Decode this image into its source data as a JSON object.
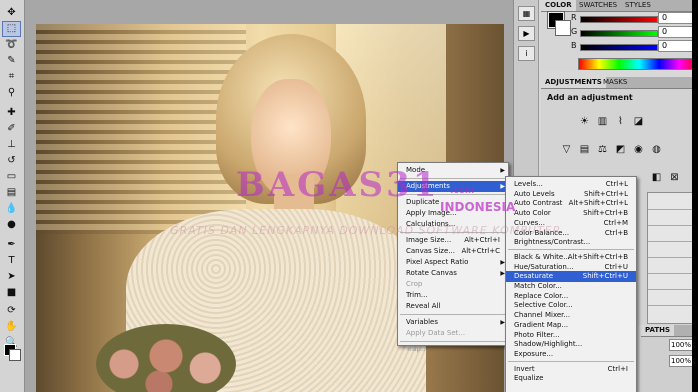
{
  "panels": {
    "color_tab": "COLOR",
    "swatches_tab": "SWATCHES",
    "styles_tab": "STYLES",
    "sliders": [
      {
        "label": "R",
        "value": "0",
        "gradient": "linear-gradient(90deg,#000,#ff0000)"
      },
      {
        "label": "G",
        "value": "0",
        "gradient": "linear-gradient(90deg,#000,#00ff00)"
      },
      {
        "label": "B",
        "value": "0",
        "gradient": "linear-gradient(90deg,#000,#0000ff)"
      }
    ],
    "adjustments_tab": "ADJUSTMENTS",
    "masks_tab": "MASKS",
    "add_adjustment": "Add an adjustment",
    "paths_tab": "PATHS",
    "opacity_value": "100%",
    "fill_value": "100%"
  },
  "image_menu": {
    "items": [
      {
        "label": "Mode",
        "shortcut": "",
        "submenu": true,
        "disabled": false,
        "highlight": false
      },
      {
        "sep": true
      },
      {
        "label": "Adjustments",
        "shortcut": "",
        "submenu": true,
        "disabled": false,
        "highlight": true
      },
      {
        "sep": true
      },
      {
        "label": "Duplicate",
        "shortcut": "",
        "submenu": false,
        "disabled": false,
        "highlight": false
      },
      {
        "label": "Apply Image...",
        "shortcut": "",
        "submenu": false,
        "disabled": false,
        "highlight": false
      },
      {
        "label": "Calculations...",
        "shortcut": "",
        "submenu": false,
        "disabled": false,
        "highlight": false
      },
      {
        "sep": true
      },
      {
        "label": "Image Size...",
        "shortcut": "Alt+Ctrl+I",
        "submenu": false,
        "disabled": false,
        "highlight": false
      },
      {
        "label": "Canvas Size...",
        "shortcut": "Alt+Ctrl+C",
        "submenu": false,
        "disabled": false,
        "highlight": false
      },
      {
        "label": "Pixel Aspect Ratio",
        "shortcut": "",
        "submenu": true,
        "disabled": false,
        "highlight": false
      },
      {
        "label": "Rotate Canvas",
        "shortcut": "",
        "submenu": true,
        "disabled": false,
        "highlight": false
      },
      {
        "label": "Crop",
        "shortcut": "",
        "submenu": false,
        "disabled": true,
        "highlight": false
      },
      {
        "label": "Trim...",
        "shortcut": "",
        "submenu": false,
        "disabled": false,
        "highlight": false
      },
      {
        "label": "Reveal All",
        "shortcut": "",
        "submenu": false,
        "disabled": false,
        "highlight": false
      },
      {
        "sep": true
      },
      {
        "label": "Variables",
        "shortcut": "",
        "submenu": true,
        "disabled": false,
        "highlight": false
      },
      {
        "label": "Apply Data Set...",
        "shortcut": "",
        "submenu": false,
        "disabled": true,
        "highlight": false
      },
      {
        "sep": true
      },
      {
        "label": "Trap...",
        "shortcut": "",
        "submenu": false,
        "disabled": true,
        "highlight": false
      }
    ]
  },
  "adjustments_menu": {
    "items": [
      {
        "label": "Levels...",
        "shortcut": "Ctrl+L",
        "highlight": false
      },
      {
        "label": "Auto Levels",
        "shortcut": "Shift+Ctrl+L",
        "highlight": false
      },
      {
        "label": "Auto Contrast",
        "shortcut": "Alt+Shift+Ctrl+L",
        "highlight": false
      },
      {
        "label": "Auto Color",
        "shortcut": "Shift+Ctrl+B",
        "highlight": false
      },
      {
        "label": "Curves...",
        "shortcut": "Ctrl+M",
        "highlight": false
      },
      {
        "label": "Color Balance...",
        "shortcut": "Ctrl+B",
        "highlight": false
      },
      {
        "label": "Brightness/Contrast...",
        "shortcut": "",
        "highlight": false
      },
      {
        "sep": true
      },
      {
        "label": "Black & White...",
        "shortcut": "Alt+Shift+Ctrl+B",
        "highlight": false
      },
      {
        "label": "Hue/Saturation...",
        "shortcut": "Ctrl+U",
        "highlight": false
      },
      {
        "label": "Desaturate",
        "shortcut": "Shift+Ctrl+U",
        "highlight": true
      },
      {
        "label": "Match Color...",
        "shortcut": "",
        "highlight": false
      },
      {
        "label": "Replace Color...",
        "shortcut": "",
        "highlight": false
      },
      {
        "label": "Selective Color...",
        "shortcut": "",
        "highlight": false
      },
      {
        "label": "Channel Mixer...",
        "shortcut": "",
        "highlight": false
      },
      {
        "label": "Gradient Map...",
        "shortcut": "",
        "highlight": false
      },
      {
        "label": "Photo Filter...",
        "shortcut": "",
        "highlight": false
      },
      {
        "label": "Shadow/Highlight...",
        "shortcut": "",
        "highlight": false
      },
      {
        "label": "Exposure...",
        "shortcut": "",
        "highlight": false
      },
      {
        "sep": true
      },
      {
        "label": "Invert",
        "shortcut": "Ctrl+I",
        "highlight": false
      },
      {
        "label": "Equalize",
        "shortcut": "",
        "highlight": false
      }
    ]
  },
  "watermark": {
    "logo": "BAGAS31",
    "domain": ".com",
    "country": "INDONESIA",
    "tagline": "GRATIS DAN LENGKAPNYA DOWNLOAD SOFTWARE KOMPUTER"
  },
  "colors": {
    "menu_highlight": "#2f5fd0",
    "watermark": "#b428c8"
  }
}
